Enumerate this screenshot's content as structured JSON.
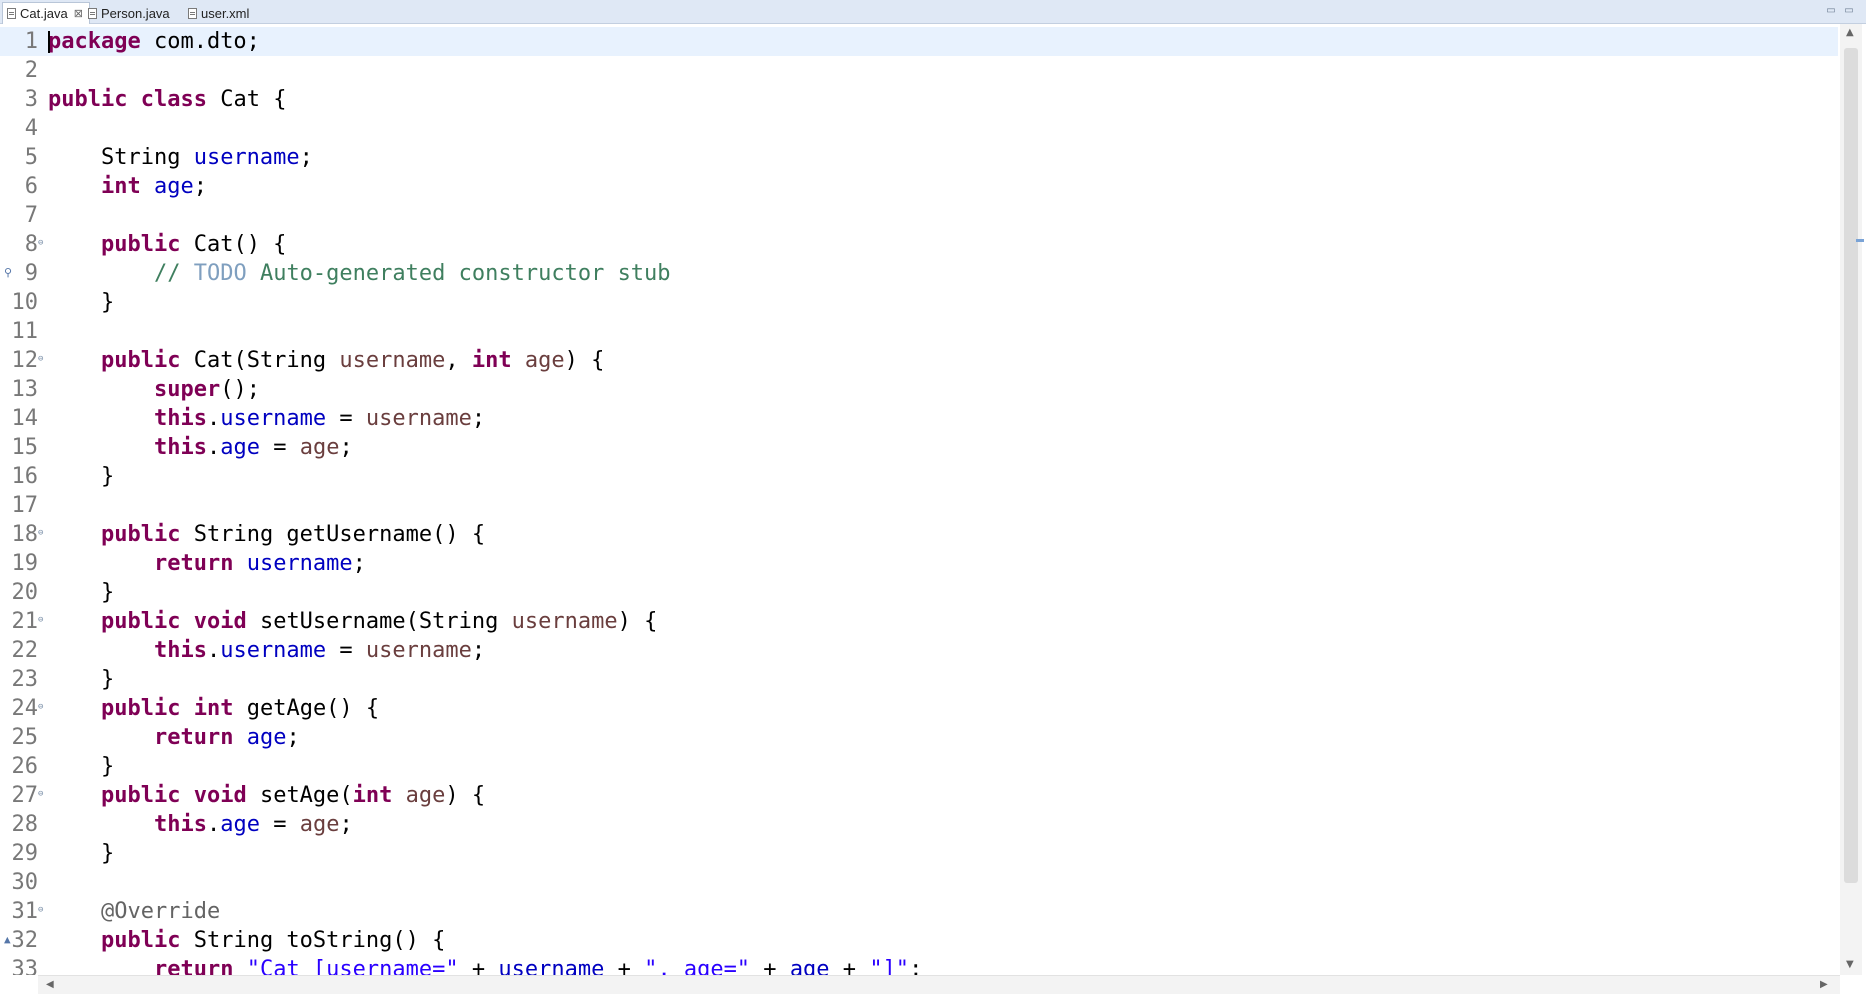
{
  "tabs": [
    {
      "label": "Cat.java",
      "active": true,
      "close": "⊠"
    },
    {
      "label": "Person.java",
      "active": false
    },
    {
      "label": "user.xml",
      "active": false
    }
  ],
  "window_controls": {
    "minimize": "▭",
    "maximize": "▭"
  },
  "colors": {
    "keyword": "#7f0055",
    "field": "#0000c0",
    "parameter": "#6a3e3e",
    "comment": "#3f7f5f",
    "todo": "#7f9fbf",
    "string": "#2a00ff",
    "annotation": "#646464",
    "line_number": "#787878",
    "current_line": "#e8f2fe"
  },
  "editor": {
    "lines": [
      {
        "num": "1",
        "current": true,
        "tokens": [
          [
            "kw",
            "package"
          ],
          [
            "",
            " com.dto;"
          ]
        ]
      },
      {
        "num": "2",
        "tokens": []
      },
      {
        "num": "3",
        "tokens": [
          [
            "kw",
            "public"
          ],
          [
            "",
            " "
          ],
          [
            "kw",
            "class"
          ],
          [
            "",
            " Cat {"
          ]
        ]
      },
      {
        "num": "4",
        "tokens": []
      },
      {
        "num": "5",
        "tokens": [
          [
            "",
            "    String "
          ],
          [
            "fld",
            "username"
          ],
          [
            "",
            ";"
          ]
        ]
      },
      {
        "num": "6",
        "tokens": [
          [
            "",
            "    "
          ],
          [
            "kw",
            "int"
          ],
          [
            "",
            " "
          ],
          [
            "fld",
            "age"
          ],
          [
            "",
            ";"
          ]
        ]
      },
      {
        "num": "7",
        "tokens": []
      },
      {
        "num": "8",
        "fold": "⊖",
        "tokens": [
          [
            "",
            "    "
          ],
          [
            "kw",
            "public"
          ],
          [
            "",
            " Cat() {"
          ]
        ]
      },
      {
        "num": "9",
        "annotation": "⚲",
        "tokens": [
          [
            "",
            "        "
          ],
          [
            "cmt",
            "// "
          ],
          [
            "todo",
            "TODO"
          ],
          [
            "cmt",
            " Auto-generated constructor stub"
          ]
        ]
      },
      {
        "num": "10",
        "tokens": [
          [
            "",
            "    }"
          ]
        ]
      },
      {
        "num": "11",
        "tokens": []
      },
      {
        "num": "12",
        "fold": "⊖",
        "tokens": [
          [
            "",
            "    "
          ],
          [
            "kw",
            "public"
          ],
          [
            "",
            " Cat(String "
          ],
          [
            "prm",
            "username"
          ],
          [
            "",
            ", "
          ],
          [
            "kw",
            "int"
          ],
          [
            "",
            " "
          ],
          [
            "prm",
            "age"
          ],
          [
            "",
            ") {"
          ]
        ]
      },
      {
        "num": "13",
        "tokens": [
          [
            "",
            "        "
          ],
          [
            "kw",
            "super"
          ],
          [
            "",
            "();"
          ]
        ]
      },
      {
        "num": "14",
        "tokens": [
          [
            "",
            "        "
          ],
          [
            "kw",
            "this"
          ],
          [
            "",
            "."
          ],
          [
            "fld",
            "username"
          ],
          [
            "",
            " = "
          ],
          [
            "prm",
            "username"
          ],
          [
            "",
            ";"
          ]
        ]
      },
      {
        "num": "15",
        "tokens": [
          [
            "",
            "        "
          ],
          [
            "kw",
            "this"
          ],
          [
            "",
            "."
          ],
          [
            "fld",
            "age"
          ],
          [
            "",
            " = "
          ],
          [
            "prm",
            "age"
          ],
          [
            "",
            ";"
          ]
        ]
      },
      {
        "num": "16",
        "tokens": [
          [
            "",
            "    }"
          ]
        ]
      },
      {
        "num": "17",
        "tokens": []
      },
      {
        "num": "18",
        "fold": "⊖",
        "tokens": [
          [
            "",
            "    "
          ],
          [
            "kw",
            "public"
          ],
          [
            "",
            " String getUsername() {"
          ]
        ]
      },
      {
        "num": "19",
        "tokens": [
          [
            "",
            "        "
          ],
          [
            "kw",
            "return"
          ],
          [
            "",
            " "
          ],
          [
            "fld",
            "username"
          ],
          [
            "",
            ";"
          ]
        ]
      },
      {
        "num": "20",
        "tokens": [
          [
            "",
            "    }"
          ]
        ]
      },
      {
        "num": "21",
        "fold": "⊖",
        "tokens": [
          [
            "",
            "    "
          ],
          [
            "kw",
            "public"
          ],
          [
            "",
            " "
          ],
          [
            "kw",
            "void"
          ],
          [
            "",
            " setUsername(String "
          ],
          [
            "prm",
            "username"
          ],
          [
            "",
            ") {"
          ]
        ]
      },
      {
        "num": "22",
        "tokens": [
          [
            "",
            "        "
          ],
          [
            "kw",
            "this"
          ],
          [
            "",
            "."
          ],
          [
            "fld",
            "username"
          ],
          [
            "",
            " = "
          ],
          [
            "prm",
            "username"
          ],
          [
            "",
            ";"
          ]
        ]
      },
      {
        "num": "23",
        "tokens": [
          [
            "",
            "    }"
          ]
        ]
      },
      {
        "num": "24",
        "fold": "⊖",
        "tokens": [
          [
            "",
            "    "
          ],
          [
            "kw",
            "public"
          ],
          [
            "",
            " "
          ],
          [
            "kw",
            "int"
          ],
          [
            "",
            " getAge() {"
          ]
        ]
      },
      {
        "num": "25",
        "tokens": [
          [
            "",
            "        "
          ],
          [
            "kw",
            "return"
          ],
          [
            "",
            " "
          ],
          [
            "fld",
            "age"
          ],
          [
            "",
            ";"
          ]
        ]
      },
      {
        "num": "26",
        "tokens": [
          [
            "",
            "    }"
          ]
        ]
      },
      {
        "num": "27",
        "fold": "⊖",
        "tokens": [
          [
            "",
            "    "
          ],
          [
            "kw",
            "public"
          ],
          [
            "",
            " "
          ],
          [
            "kw",
            "void"
          ],
          [
            "",
            " setAge("
          ],
          [
            "kw",
            "int"
          ],
          [
            "",
            " "
          ],
          [
            "prm",
            "age"
          ],
          [
            "",
            ") {"
          ]
        ]
      },
      {
        "num": "28",
        "tokens": [
          [
            "",
            "        "
          ],
          [
            "kw",
            "this"
          ],
          [
            "",
            "."
          ],
          [
            "fld",
            "age"
          ],
          [
            "",
            " = "
          ],
          [
            "prm",
            "age"
          ],
          [
            "",
            ";"
          ]
        ]
      },
      {
        "num": "29",
        "tokens": [
          [
            "",
            "    }"
          ]
        ]
      },
      {
        "num": "30",
        "tokens": []
      },
      {
        "num": "31",
        "fold": "⊖",
        "tokens": [
          [
            "",
            "    "
          ],
          [
            "annot",
            "@Override"
          ]
        ]
      },
      {
        "num": "32",
        "annotation": "▲",
        "tokens": [
          [
            "",
            "    "
          ],
          [
            "kw",
            "public"
          ],
          [
            "",
            " String toString() {"
          ]
        ]
      },
      {
        "num": "33",
        "tokens": [
          [
            "",
            "        "
          ],
          [
            "kw",
            "return"
          ],
          [
            "",
            " "
          ],
          [
            "str",
            "\"Cat [username=\""
          ],
          [
            "",
            " + "
          ],
          [
            "fld",
            "username"
          ],
          [
            "",
            " + "
          ],
          [
            "str",
            "\", age=\""
          ],
          [
            "",
            " + "
          ],
          [
            "fld",
            "age"
          ],
          [
            "",
            " + "
          ],
          [
            "str",
            "\"]\""
          ],
          [
            "",
            ";"
          ]
        ]
      }
    ]
  },
  "scrollbars": {
    "up": "▲",
    "down": "▼",
    "left": "◀",
    "right": "▶"
  }
}
